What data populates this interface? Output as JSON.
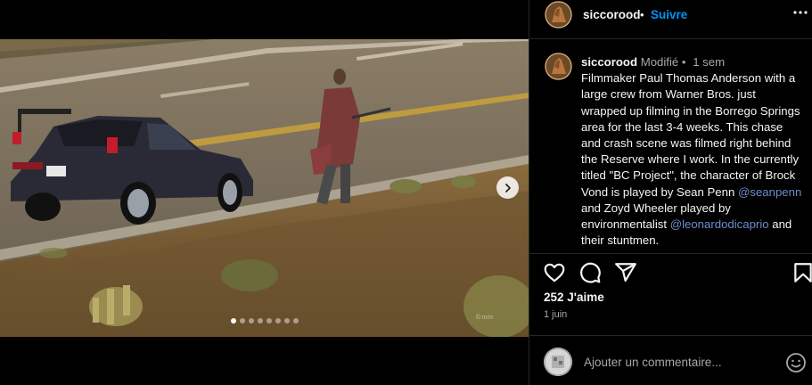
{
  "post": {
    "username": "siccorood",
    "follow_label": "Suivre",
    "more_icon": "more-horizontal-icon"
  },
  "caption": {
    "username": "siccorood",
    "edited": "Modifié",
    "separator": "•",
    "time": "1 sem",
    "text_1": "Filmmaker Paul Thomas Anderson with a large crew from Warner Bros. just wrapped up filming in the Borrego Springs area for the last 3-4 weeks. This chase and crash scene was filmed right behind the Reserve where I work. In the currently titled \"BC Project\", the character of Brock Vond is played by Sean Penn ",
    "mention_1": "@seanpenn",
    "text_2": " and Zoyd Wheeler played by environmentalist ",
    "mention_2": "@leonardodicaprio",
    "text_3": " and their stuntmen."
  },
  "actions": {
    "like_icon": "heart-icon",
    "comment_icon": "comment-icon",
    "share_icon": "share-icon",
    "save_icon": "bookmark-icon"
  },
  "likes": "252 J'aime",
  "date": "1 juin",
  "comment": {
    "placeholder": "Ajouter un commentaire...",
    "emoji_icon": "emoji-icon"
  },
  "carousel": {
    "total_slides": 8,
    "current_slide": 1,
    "watermark": "©mm"
  },
  "colors": {
    "background": "#000000",
    "text": "#f5f5f5",
    "secondary": "#a8a8a8",
    "accent": "#0095f6",
    "mention": "#6f8ccd",
    "border": "#262626"
  }
}
